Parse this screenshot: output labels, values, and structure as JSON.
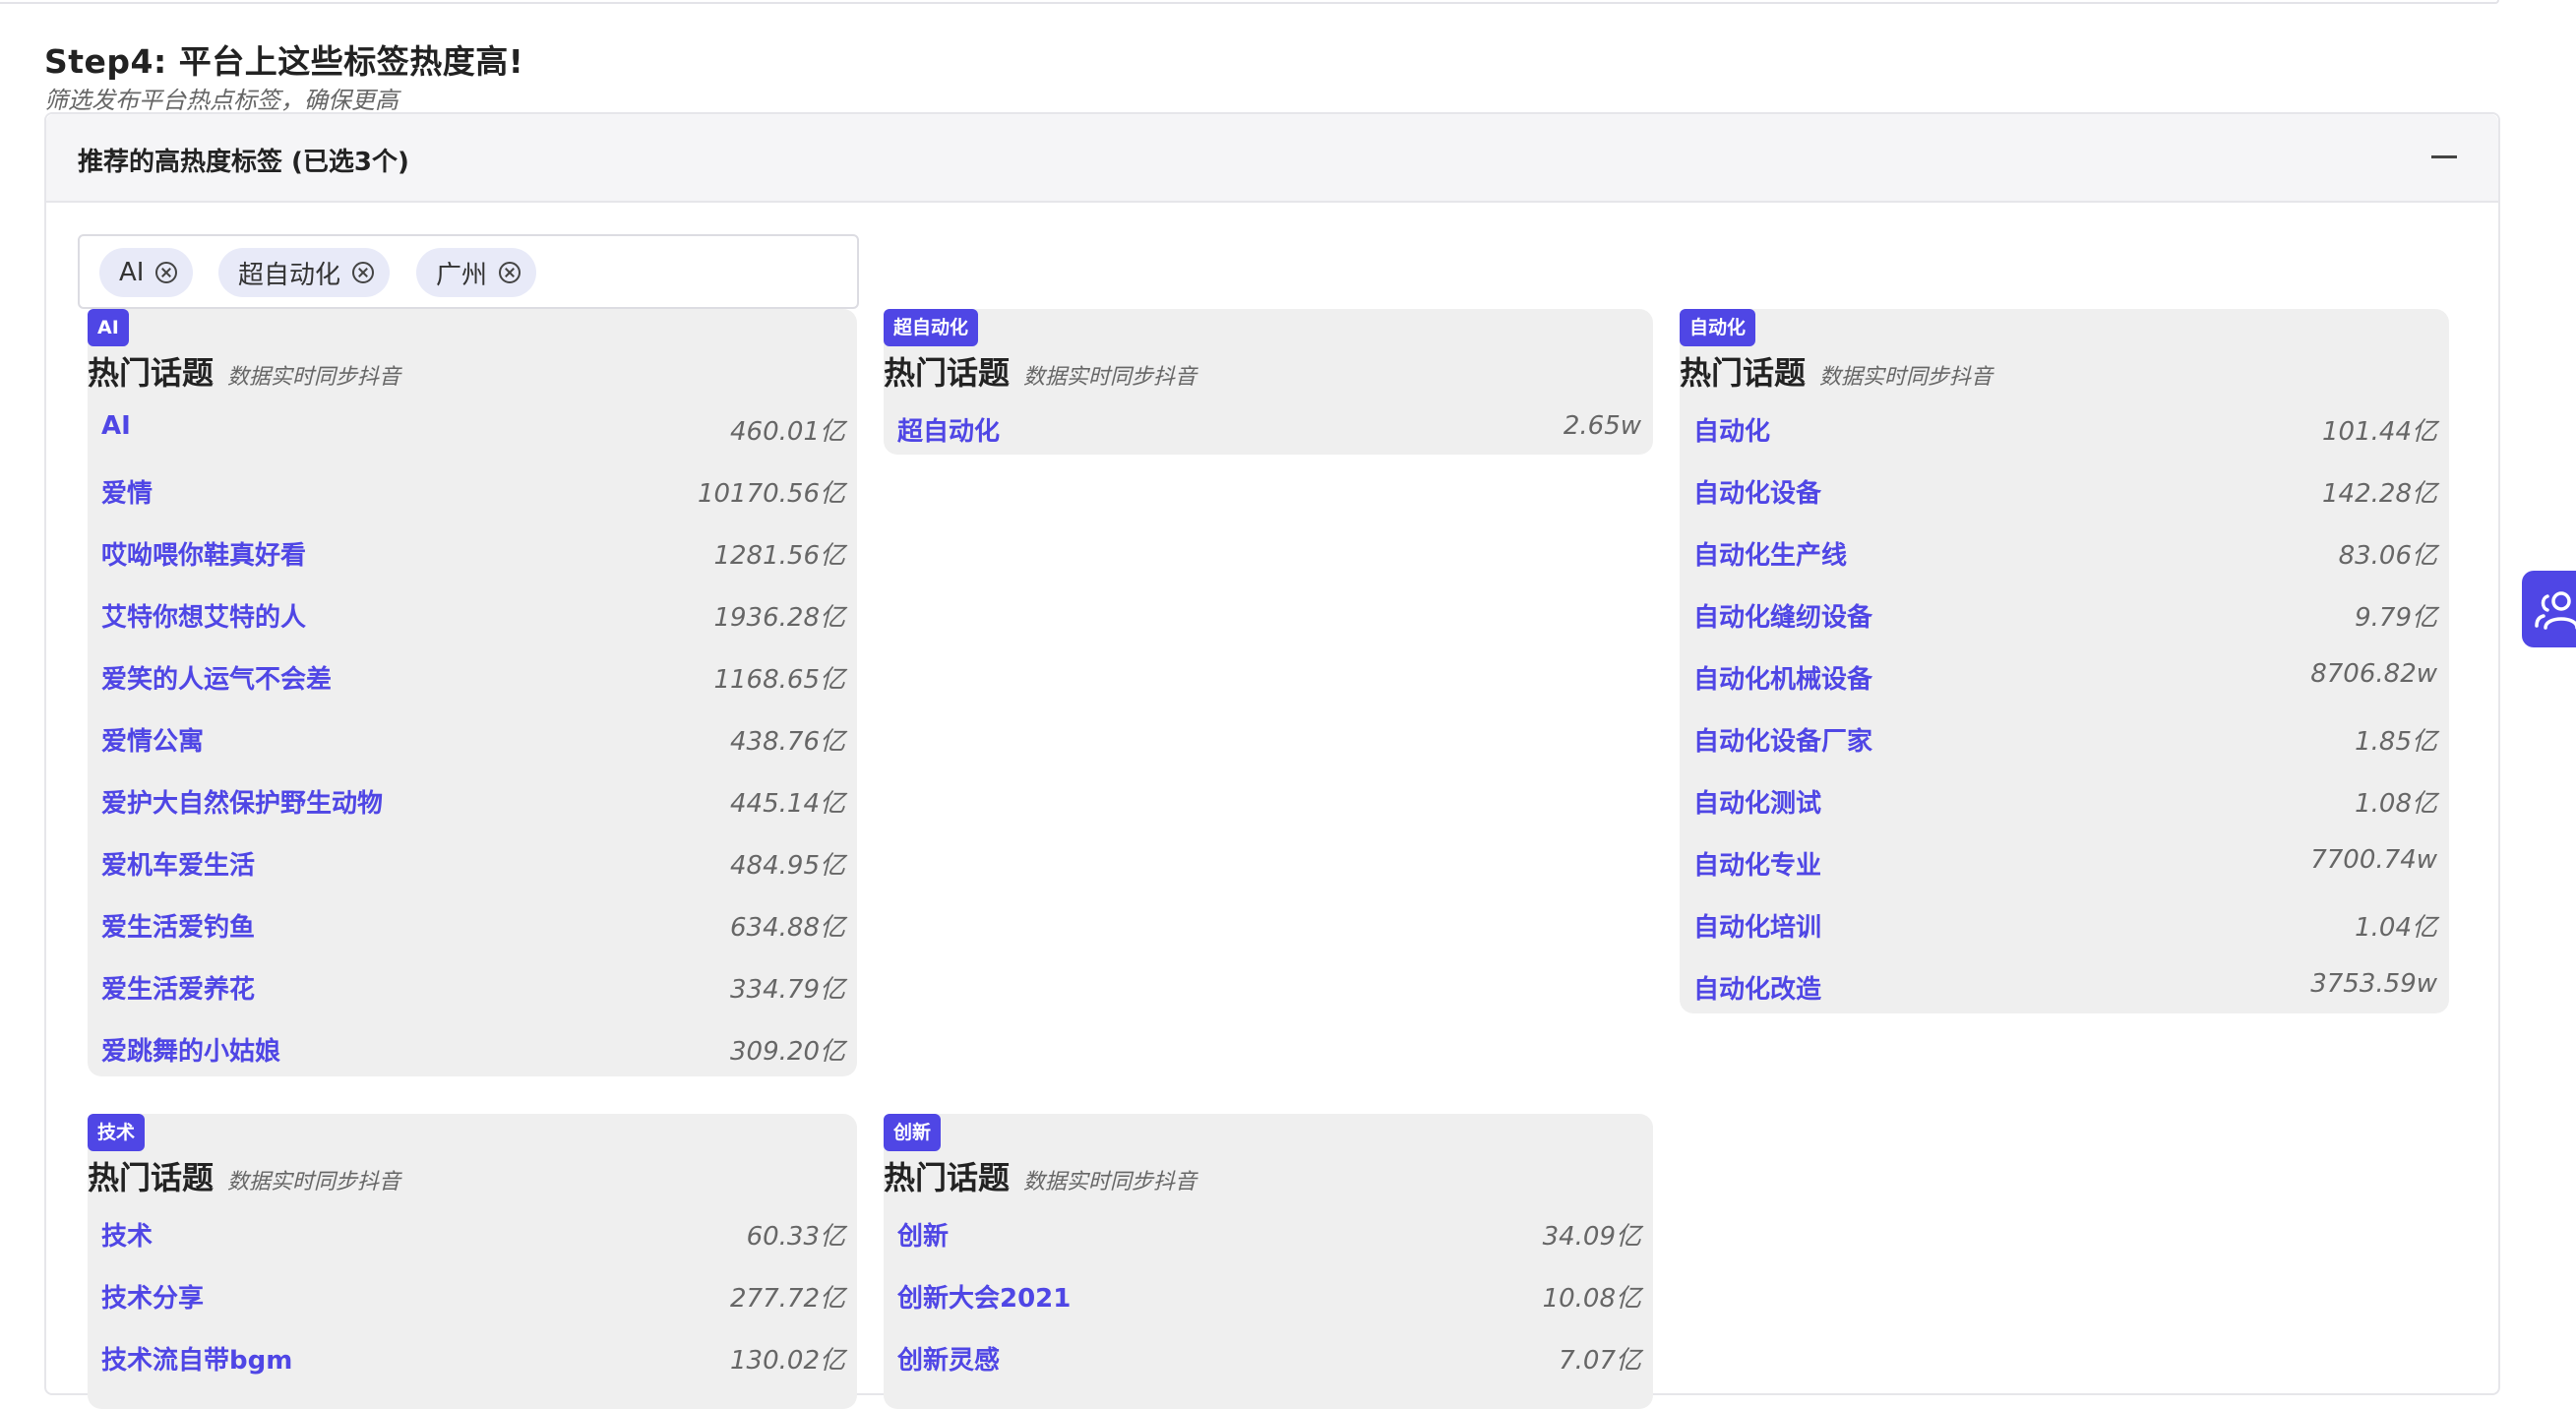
{
  "step": {
    "title": "Step4: 平台上这些标签热度高!",
    "subtitle": "筛选发布平台热点标签，确保更高"
  },
  "panel": {
    "title": "推荐的高热度标签 (已选3个)"
  },
  "selected_tags": [
    {
      "label": "AI"
    },
    {
      "label": "超自动化"
    },
    {
      "label": "广州"
    }
  ],
  "card_common": {
    "title": "热门话题",
    "subtitle": "数据实时同步抖音"
  },
  "cards": [
    {
      "tag": "AI",
      "topics": [
        {
          "name": "AI",
          "count": "460.01亿"
        },
        {
          "name": "爱情",
          "count": "10170.56亿"
        },
        {
          "name": "哎呦喂你鞋真好看",
          "count": "1281.56亿"
        },
        {
          "name": "艾特你想艾特的人",
          "count": "1936.28亿"
        },
        {
          "name": "爱笑的人运气不会差",
          "count": "1168.65亿"
        },
        {
          "name": "爱情公寓",
          "count": "438.76亿"
        },
        {
          "name": "爱护大自然保护野生动物",
          "count": "445.14亿"
        },
        {
          "name": "爱机车爱生活",
          "count": "484.95亿"
        },
        {
          "name": "爱生活爱钓鱼",
          "count": "634.88亿"
        },
        {
          "name": "爱生活爱养花",
          "count": "334.79亿"
        },
        {
          "name": "爱跳舞的小姑娘",
          "count": "309.20亿"
        }
      ]
    },
    {
      "tag": "超自动化",
      "topics": [
        {
          "name": "超自动化",
          "count": "2.65w"
        }
      ]
    },
    {
      "tag": "自动化",
      "topics": [
        {
          "name": "自动化",
          "count": "101.44亿"
        },
        {
          "name": "自动化设备",
          "count": "142.28亿"
        },
        {
          "name": "自动化生产线",
          "count": "83.06亿"
        },
        {
          "name": "自动化缝纫设备",
          "count": "9.79亿"
        },
        {
          "name": "自动化机械设备",
          "count": "8706.82w"
        },
        {
          "name": "自动化设备厂家",
          "count": "1.85亿"
        },
        {
          "name": "自动化测试",
          "count": "1.08亿"
        },
        {
          "name": "自动化专业",
          "count": "7700.74w"
        },
        {
          "name": "自动化培训",
          "count": "1.04亿"
        },
        {
          "name": "自动化改造",
          "count": "3753.59w"
        }
      ]
    },
    {
      "tag": "技术",
      "topics": [
        {
          "name": "技术",
          "count": "60.33亿"
        },
        {
          "name": "技术分享",
          "count": "277.72亿"
        },
        {
          "name": "技术流自带bgm",
          "count": "130.02亿"
        }
      ]
    },
    {
      "tag": "创新",
      "topics": [
        {
          "name": "创新",
          "count": "34.09亿"
        },
        {
          "name": "创新大会2021",
          "count": "10.08亿"
        },
        {
          "name": "创新灵感",
          "count": "7.07亿"
        }
      ]
    }
  ],
  "icons": {
    "collapse": "minus-icon",
    "chip_remove": "circle-x-icon",
    "side": "users-icon"
  },
  "colors": {
    "accent": "#4f46e5",
    "card_bg": "#efefef",
    "chip_bg": "#e8eaf8"
  }
}
